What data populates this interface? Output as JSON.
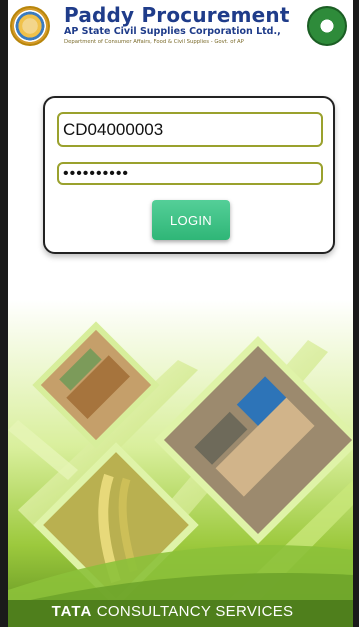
{
  "header": {
    "title": "Paddy Procurement",
    "subtitle": "AP State Civil Supplies Corporation Ltd.,",
    "department": "Department of Consumer Affairs, Food & Civil Supplies - Govt. of AP"
  },
  "login": {
    "user_id_value": "CD04000003",
    "password_value": "••••••••••",
    "login_label": "LOGIN"
  },
  "footer": {
    "brand": "TATA",
    "company": " CONSULTANCY SERVICES"
  },
  "colors": {
    "title_blue": "#1f3c8a",
    "field_border": "#9aa12d",
    "login_button": "#34b87a",
    "footer_green": "#4f7f1c"
  },
  "icons": {
    "left_logo": "ap-govt-emblem",
    "right_logo": "civil-supplies-seal"
  }
}
